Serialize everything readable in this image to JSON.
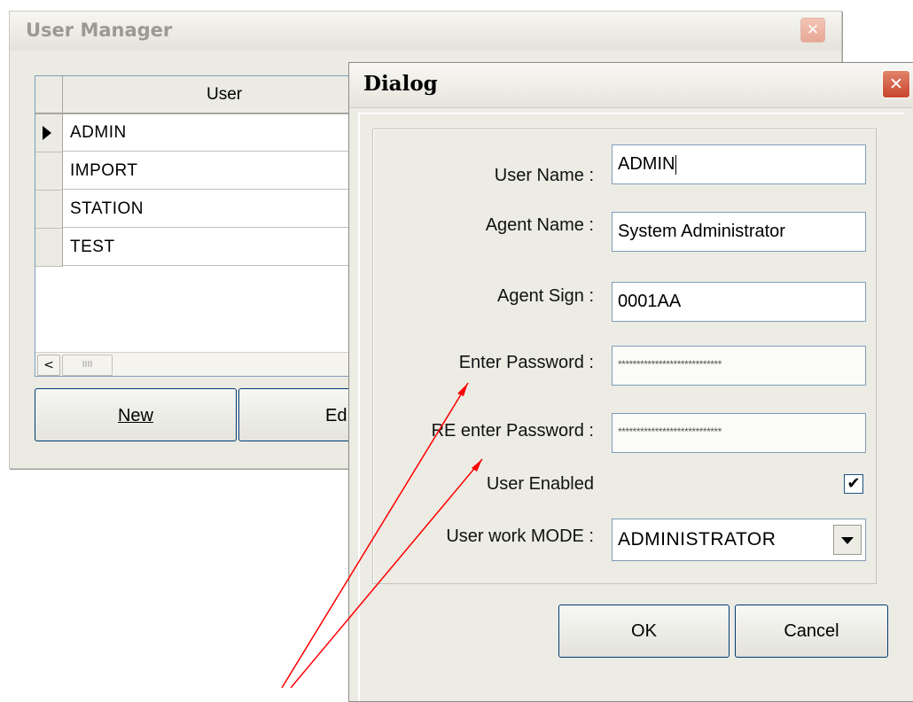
{
  "user_manager": {
    "title": "User Manager",
    "close_icon": "close-icon",
    "grid": {
      "column_header": "User",
      "sort_icon": "▽",
      "rows": [
        "ADMIN",
        "IMPORT",
        "STATION",
        "TEST"
      ],
      "selected_row": 0,
      "scroll_left": "<",
      "scroll_thumb": "IIII"
    },
    "buttons": {
      "new_label": "New",
      "edit_label": "Ed"
    }
  },
  "dialog": {
    "title": "Dialog",
    "close_glyph": "✕",
    "labels": {
      "user_name": "User Name :",
      "agent_name": "Agent Name :",
      "agent_sign": "Agent Sign :",
      "enter_password": "Enter Password :",
      "reenter_password": "RE enter Password :",
      "user_enabled": "User Enabled",
      "work_mode": "User work MODE :"
    },
    "values": {
      "user_name": "ADMIN",
      "agent_name": "System Administrator",
      "agent_sign": "0001AA",
      "enter_password": "****************************",
      "reenter_password": "****************************",
      "user_enabled_mark": "✔",
      "work_mode": "ADMINISTRATOR"
    },
    "buttons": {
      "ok_label": "OK",
      "cancel_label": "Cancel"
    }
  },
  "annotation": {
    "color": "#ff0000"
  }
}
